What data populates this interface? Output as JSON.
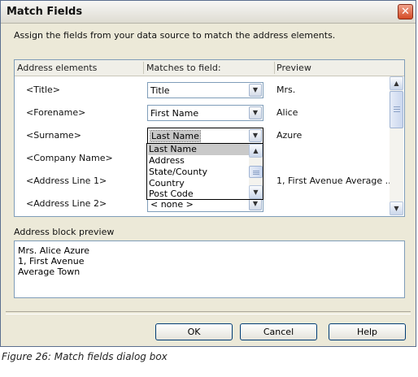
{
  "dialog": {
    "title": "Match Fields",
    "close_glyph": "✕",
    "instruction": "Assign the fields from your data source to match the address elements."
  },
  "table": {
    "headers": {
      "elements": "Address elements",
      "matches": "Matches to field:",
      "preview": "Preview"
    },
    "rows": [
      {
        "label": "<Title>",
        "field": "Title",
        "preview": "Mrs."
      },
      {
        "label": "<Forename>",
        "field": "First Name",
        "preview": "Alice"
      },
      {
        "label": "<Surname>",
        "field": "Last Name",
        "preview": "Azure"
      },
      {
        "label": "<Company Name>",
        "field": "",
        "preview": ""
      },
      {
        "label": "<Address Line 1>",
        "field": "",
        "preview": "1, First Avenue Average ..."
      },
      {
        "label": "<Address Line 2>",
        "field": "< none >",
        "preview": ""
      }
    ]
  },
  "dropdown": {
    "options": [
      "Last Name",
      "Address",
      "State/County",
      "Country",
      "Post Code"
    ],
    "selected": "Last Name"
  },
  "address_block": {
    "label": "Address block preview",
    "lines": [
      "Mrs. Alice Azure",
      "1, First Avenue",
      "Average Town"
    ]
  },
  "buttons": {
    "ok": "OK",
    "cancel": "Cancel",
    "help": "Help"
  },
  "caption": "Figure 26: Match fields dialog box"
}
